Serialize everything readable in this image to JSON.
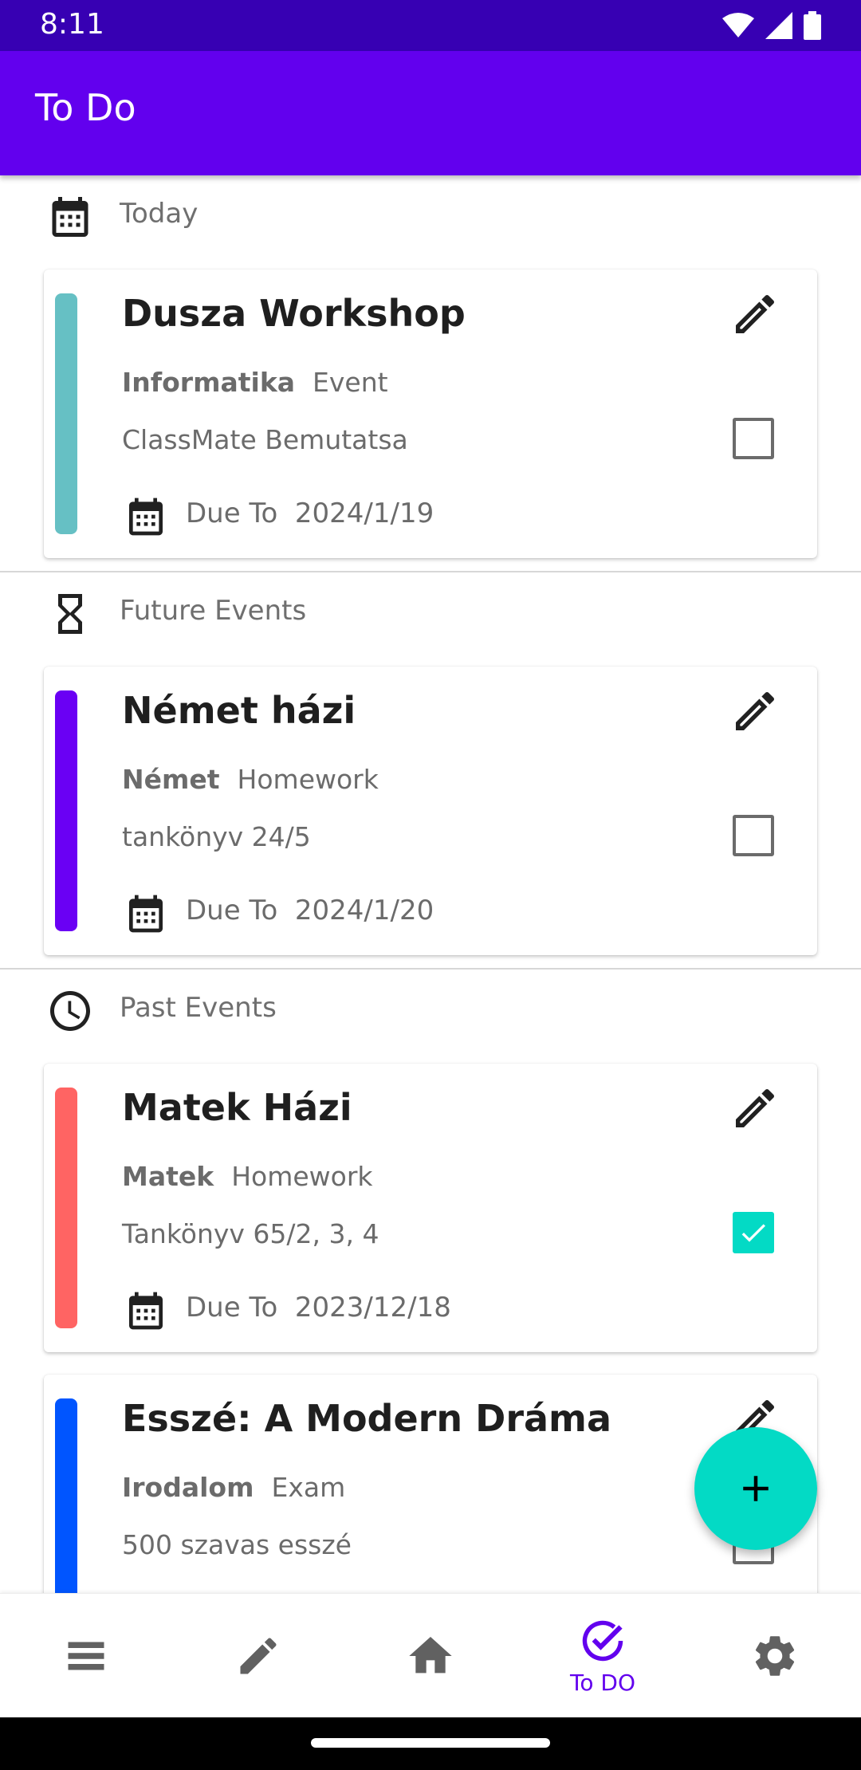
{
  "status_bar": {
    "time": "8:11"
  },
  "app_bar": {
    "title": "To Do"
  },
  "sections": {
    "today": {
      "label": "Today"
    },
    "future": {
      "label": "Future Events"
    },
    "past": {
      "label": "Past Events"
    }
  },
  "tasks": [
    {
      "title": "Dusza Workshop",
      "subject": "Informatika",
      "type": "Event",
      "description": "ClassMate Bemutatsa",
      "due_label": "Due To",
      "due_date": "2024/1/19",
      "color": "#66c0c4",
      "checked": false
    },
    {
      "title": "Német házi",
      "subject": "Német",
      "type": "Homework",
      "description": "tankönyv 24/5",
      "due_label": "Due To",
      "due_date": "2024/1/20",
      "color": "#6a00f4",
      "checked": false
    },
    {
      "title": "Matek Házi",
      "subject": "Matek",
      "type": "Homework",
      "description": "Tankönyv 65/2, 3, 4",
      "due_label": "Due To",
      "due_date": "2023/12/18",
      "color": "#ff6463",
      "checked": true
    },
    {
      "title": "Esszé: A Modern Dráma",
      "subject": "Irodalom",
      "type": "Exam",
      "description": "500 szavas esszé",
      "color": "#0055ff",
      "checked": false
    }
  ],
  "bottom_nav": {
    "items": [
      {
        "icon": "menu-icon"
      },
      {
        "icon": "pencil-icon"
      },
      {
        "icon": "home-icon"
      },
      {
        "icon": "check-circle-icon",
        "label": "To DO",
        "active": true
      },
      {
        "icon": "gear-icon"
      }
    ]
  },
  "colors": {
    "primary": "#6200ee",
    "primary_dark": "#3700b3",
    "accent": "#03dac5"
  }
}
